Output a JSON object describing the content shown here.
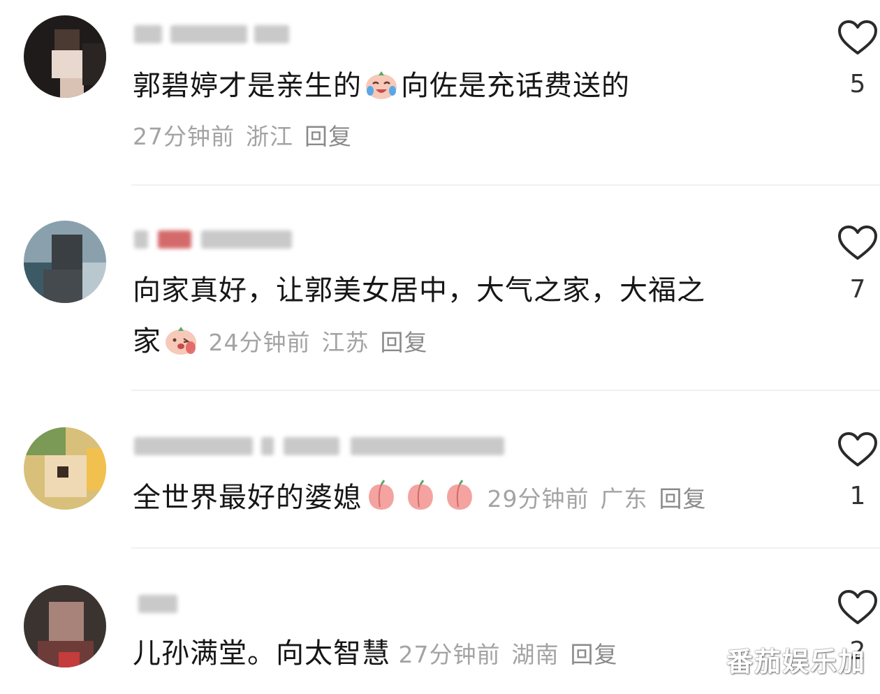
{
  "comments": [
    {
      "text_before_emoji": "郭碧婷才是亲生的",
      "emoji_name": "crying-laughing-peach-icon",
      "text_after_emoji": "向佐是充话费送的",
      "time": "27分钟前",
      "location": "浙江",
      "reply_label": "回复",
      "likes": "5"
    },
    {
      "line1": "向家真好，让郭美女居中，大气之家，大福之",
      "line2_text": "家",
      "emoji_name": "blushing-peach-icon",
      "time": "24分钟前",
      "location": "江苏",
      "reply_label": "回复",
      "likes": "7"
    },
    {
      "text": "全世界最好的婆媳",
      "emoji_name": "peach-icon",
      "time": "29分钟前",
      "location": "广东",
      "reply_label": "回复",
      "likes": "1"
    },
    {
      "text": "儿孙满堂。向太智慧",
      "time": "27分钟前",
      "location": "湖南",
      "reply_label": "回复",
      "likes": "2"
    }
  ],
  "watermark": "番茄娱乐加",
  "colors": {
    "text": "#161616",
    "meta": "#a3a3a3",
    "heart_outline": "#2a2a2a",
    "divider": "#f0f0f0"
  }
}
